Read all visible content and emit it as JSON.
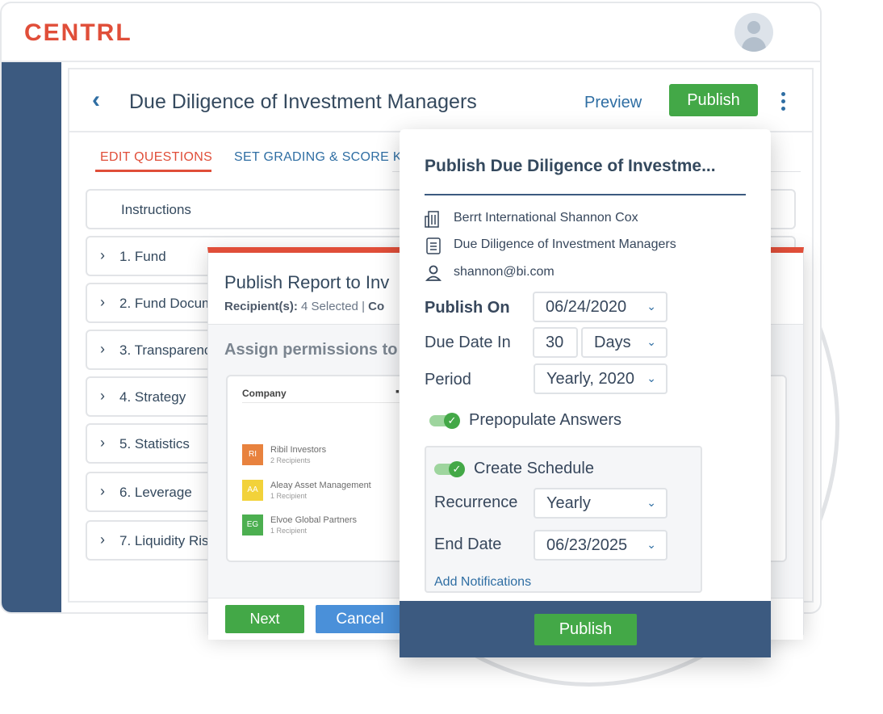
{
  "logo": "CENTRL",
  "header": {
    "title": "Due Diligence of Investment Managers",
    "preview": "Preview",
    "publish": "Publish"
  },
  "tabs": {
    "edit": "EDIT QUESTIONS",
    "grading": "SET GRADING & SCORE KEY"
  },
  "questions": [
    "Instructions",
    "1. Fund",
    "2. Fund Docum",
    "3. Transparenc",
    "4. Strategy",
    "5. Statistics",
    "6. Leverage",
    "7. Liquidity Ris"
  ],
  "report_modal": {
    "title": "Publish Report to Inv",
    "recipients_label": "Recipient(s):",
    "recipients_value": "4 Selected",
    "sep": "|",
    "trail": "Co",
    "assign": "Assign permissions to",
    "column_company": "Company",
    "companies": [
      {
        "initials": "RI",
        "name": "Ribil Investors",
        "recipients": "2 Recipients",
        "color": "#e8823e"
      },
      {
        "initials": "AA",
        "name": "Aleay Asset Management",
        "recipients": "1 Recipient",
        "color": "#f2d23a"
      },
      {
        "initials": "EG",
        "name": "Elvoe Global Partners",
        "recipients": "1 Recipient",
        "color": "#4caf50"
      }
    ],
    "next": "Next",
    "cancel": "Cancel"
  },
  "publish_modal": {
    "title": "Publish Due Diligence of Investme...",
    "company": "Berrt International Shannon Cox",
    "questionnaire": "Due Diligence of Investment Managers",
    "email": "shannon@bi.com",
    "publish_on_label": "Publish On",
    "publish_on_value": "06/24/2020",
    "due_label": "Due Date In",
    "due_number": "30",
    "due_unit": "Days",
    "period_label": "Period",
    "period_value": "Yearly, 2020",
    "prepopulate": "Prepopulate Answers",
    "create_schedule": "Create Schedule",
    "recurrence_label": "Recurrence",
    "recurrence_value": "Yearly",
    "end_label": "End Date",
    "end_value": "06/23/2025",
    "add_notifications": "Add Notifications",
    "publish": "Publish"
  },
  "icons": [
    "chevron-left-icon",
    "kebab-icon",
    "chevron-right-icon",
    "building-icon",
    "document-icon",
    "user-icon",
    "chevron-down-icon",
    "check-icon"
  ]
}
